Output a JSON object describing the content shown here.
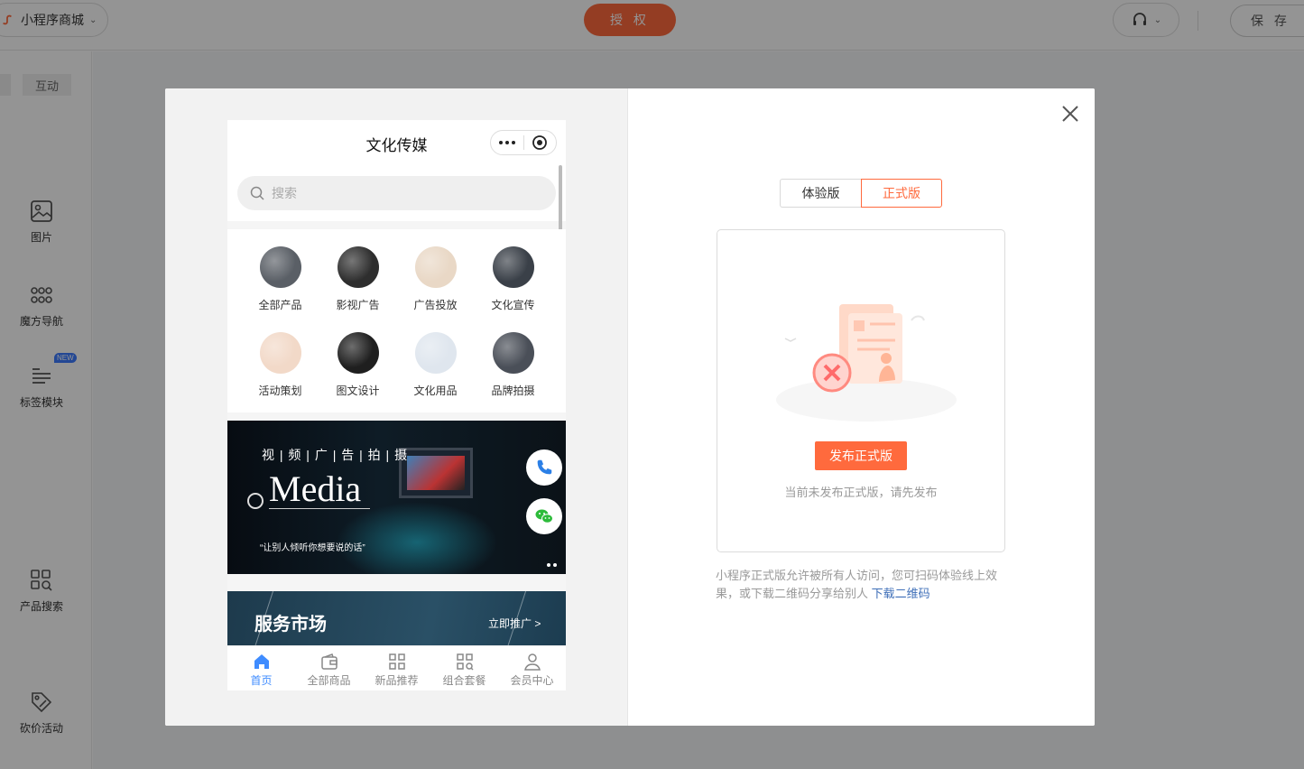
{
  "topbar": {
    "store_name": "小程序商城",
    "auth_label": "授 权",
    "save_label": "保 存"
  },
  "sidebar": {
    "tab_label": "互动",
    "items": [
      {
        "label": "图片",
        "icon": "image-icon"
      },
      {
        "label": "魔方导航",
        "icon": "grid-dots-icon"
      },
      {
        "label": "标签模块",
        "icon": "tag-list-icon",
        "badge": "NEW"
      },
      {
        "label": "产品搜索",
        "icon": "product-search-icon"
      },
      {
        "label": "砍价活动",
        "icon": "bargain-icon"
      }
    ]
  },
  "phone": {
    "title": "文化传媒",
    "search_placeholder": "搜索",
    "nav_items": [
      {
        "label": "全部产品",
        "color": "#5a5f66"
      },
      {
        "label": "影视广告",
        "color": "#2e2e2e"
      },
      {
        "label": "广告投放",
        "color": "#e9d8c6"
      },
      {
        "label": "文化宣传",
        "color": "#3a4048"
      },
      {
        "label": "活动策划",
        "color": "#f2d9c8"
      },
      {
        "label": "图文设计",
        "color": "#1f1f1f"
      },
      {
        "label": "文化用品",
        "color": "#dfe6ee"
      },
      {
        "label": "品牌拍摄",
        "color": "#4a4f58"
      }
    ],
    "banner": {
      "subtitle": "视 | 频 | 广 | 告 | 拍 | 摄",
      "title": "Media",
      "quote": "“让别人倾听你想要说的话”"
    },
    "service": {
      "title": "服务市场",
      "link": "立即推广 >"
    },
    "tabs": [
      {
        "label": "首页",
        "active": true
      },
      {
        "label": "全部商品",
        "active": false
      },
      {
        "label": "新品推荐",
        "active": false
      },
      {
        "label": "组合套餐",
        "active": false
      },
      {
        "label": "会员中心",
        "active": false
      }
    ]
  },
  "publish_panel": {
    "version_trial": "体验版",
    "version_official": "正式版",
    "publish_button": "发布正式版",
    "card_hint": "当前未发布正式版，请先发布",
    "description": "小程序正式版允许被所有人访问，您可扫码体验线上效果，或下载二维码分享给别人",
    "download_link": "下载二维码"
  },
  "colors": {
    "accent": "#ff6a3d",
    "tab_active": "#3f8cff",
    "link": "#3f6fb8"
  }
}
